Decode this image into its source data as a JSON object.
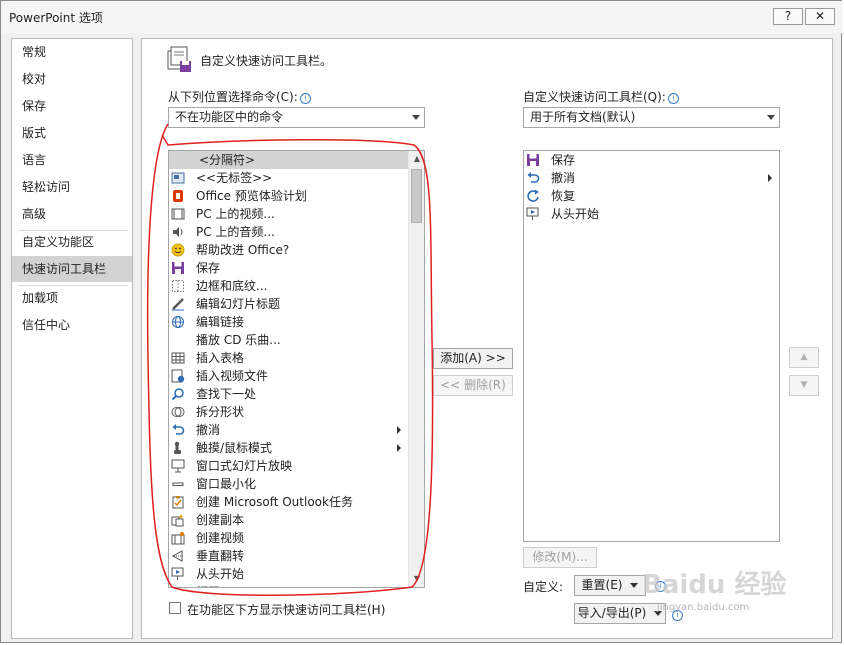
{
  "window": {
    "title": "PowerPoint 选项",
    "help_label": "?",
    "close_label": "✕"
  },
  "nav": {
    "items": [
      {
        "label": "常规"
      },
      {
        "label": "校对"
      },
      {
        "label": "保存"
      },
      {
        "label": "版式"
      },
      {
        "label": "语言"
      },
      {
        "label": "轻松访问"
      },
      {
        "label": "高级"
      },
      {
        "label": "自定义功能区"
      },
      {
        "label": "快速访问工具栏",
        "selected": true
      },
      {
        "label": "加载项"
      },
      {
        "label": "信任中心"
      }
    ]
  },
  "section": {
    "heading": "自定义快速访问工具栏。",
    "icon": "toolbar-save-icon"
  },
  "left": {
    "choose_label": "从下列位置选择命令(C):",
    "choose_value": "不在功能区中的命令",
    "commands": [
      {
        "label": "<分隔符>",
        "icon": "none",
        "selected": true
      },
      {
        "label": "<<无标签>>",
        "icon": "image-icon"
      },
      {
        "label": "Office 预览体验计划",
        "icon": "office-icon"
      },
      {
        "label": "PC 上的视频...",
        "icon": "film-icon"
      },
      {
        "label": "PC 上的音频...",
        "icon": "speaker-icon"
      },
      {
        "label": "帮助改进 Office?",
        "icon": "smiley-icon"
      },
      {
        "label": "保存",
        "icon": "floppy-icon"
      },
      {
        "label": "边框和底纹...",
        "icon": "border-icon"
      },
      {
        "label": "编辑幻灯片标题",
        "icon": "pencil-icon"
      },
      {
        "label": "编辑链接",
        "icon": "link-icon"
      },
      {
        "label": "播放 CD 乐曲...",
        "icon": "none"
      },
      {
        "label": "插入表格",
        "icon": "table-icon"
      },
      {
        "label": "插入视频文件",
        "icon": "video-file-icon"
      },
      {
        "label": "查找下一处",
        "icon": "find-icon"
      },
      {
        "label": "拆分形状",
        "icon": "shapes-icon"
      },
      {
        "label": "撤消",
        "icon": "undo-icon",
        "submenu": true
      },
      {
        "label": "触摸/鼠标模式",
        "icon": "touch-icon",
        "submenu": true
      },
      {
        "label": "窗口式幻灯片放映",
        "icon": "window-show-icon"
      },
      {
        "label": "窗口最小化",
        "icon": "minimize-icon"
      },
      {
        "label": "创建 Microsoft Outlook任务",
        "icon": "task-icon"
      },
      {
        "label": "创建副本",
        "icon": "copy-icon"
      },
      {
        "label": "创建视频",
        "icon": "create-video-icon"
      },
      {
        "label": "垂直翻转",
        "icon": "flip-icon"
      },
      {
        "label": "从头开始",
        "icon": "slideshow-start-icon"
      },
      {
        "label": "打开",
        "icon": "open-icon"
      }
    ],
    "show_below_label": "在功能区下方显示快速访问工具栏(H)"
  },
  "middle": {
    "add_label": "添加(A) >>",
    "remove_label": "<< 删除(R)"
  },
  "right": {
    "customize_label": "自定义快速访问工具栏(Q):",
    "customize_value": "用于所有文档(默认)",
    "commands": [
      {
        "label": "保存",
        "icon": "floppy-icon"
      },
      {
        "label": "撤消",
        "icon": "undo-icon",
        "submenu": true
      },
      {
        "label": "恢复",
        "icon": "redo-icon"
      },
      {
        "label": "从头开始",
        "icon": "slideshow-start-icon"
      }
    ],
    "modify_label": "修改(M)...",
    "customizations_label": "自定义:",
    "reset_label": "重置(E)",
    "import_export_label": "导入/导出(P)",
    "move_up_label": "▲",
    "move_down_label": "▼"
  },
  "watermark": {
    "text": "Baidu 经验",
    "url": "jingyan.baidu.com"
  },
  "colors": {
    "accent_purple": "#7a3e9d",
    "accent_blue": "#2f6cb5",
    "annotation_red": "#e02020"
  }
}
